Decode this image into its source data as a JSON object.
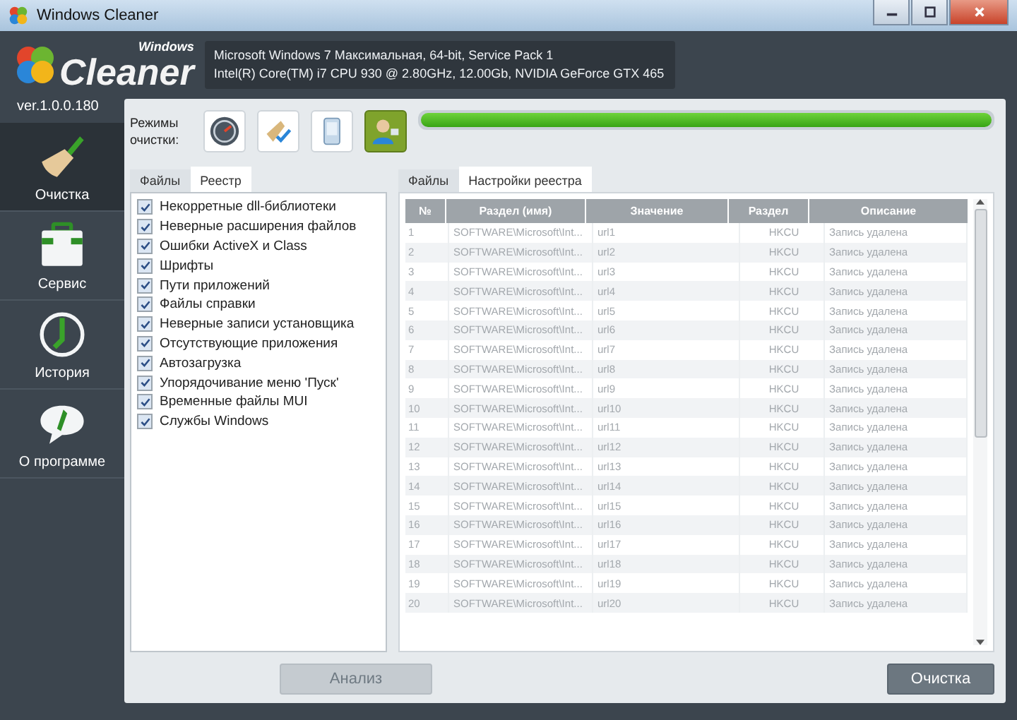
{
  "window": {
    "title": "Windows Cleaner"
  },
  "logo": {
    "small": "Windows",
    "big": "Cleaner",
    "version": "ver.1.0.0.180"
  },
  "system_info": [
    "Microsoft Windows 7 Максимальная, 64-bit, Service Pack 1",
    "Intel(R) Core(TM) i7 CPU 930 @ 2.80GHz, 12.00Gb, NVIDIA GeForce GTX 465"
  ],
  "sidebar": {
    "items": [
      {
        "label": "Очистка",
        "kind": "broom",
        "selected": true
      },
      {
        "label": "Сервис",
        "kind": "toolbox",
        "selected": false
      },
      {
        "label": "История",
        "kind": "clock",
        "selected": false
      },
      {
        "label": "О программе",
        "kind": "info",
        "selected": false
      }
    ]
  },
  "modes": {
    "label": "Режимы очистки:",
    "items": [
      {
        "kind": "gauge",
        "selected": false
      },
      {
        "kind": "broom",
        "selected": false
      },
      {
        "kind": "phone",
        "selected": false
      },
      {
        "kind": "person",
        "selected": true
      }
    ]
  },
  "progress": {
    "level": 1
  },
  "left_tabs": [
    {
      "label": "Файлы",
      "selected": false
    },
    {
      "label": "Реестр",
      "selected": true
    }
  ],
  "checklist": [
    {
      "label": "Некорретные dll-библиотеки",
      "checked": true
    },
    {
      "label": "Неверные расширения файлов",
      "checked": true
    },
    {
      "label": "Ошибки ActiveX и Class",
      "checked": true
    },
    {
      "label": "Шрифты",
      "checked": true
    },
    {
      "label": "Пути приложений",
      "checked": true
    },
    {
      "label": "Файлы справки",
      "checked": true
    },
    {
      "label": "Неверные записи установщика",
      "checked": true
    },
    {
      "label": "Отсутствующие приложения",
      "checked": true
    },
    {
      "label": "Автозагрузка",
      "checked": true
    },
    {
      "label": "Упорядочивание меню 'Пуск'",
      "checked": true
    },
    {
      "label": "Временные файлы MUI",
      "checked": true
    },
    {
      "label": "Службы Windows",
      "checked": true
    }
  ],
  "right_tabs": [
    {
      "label": "Файлы",
      "selected": false
    },
    {
      "label": "Настройки реестра",
      "selected": true
    }
  ],
  "table": {
    "columns": [
      "№",
      "Раздел (имя)",
      "Значение",
      "Раздел",
      "Описание"
    ],
    "rows": [
      [
        "1",
        "SOFTWARE\\Microsoft\\Int...",
        "url1",
        "HKCU",
        "Запись удалена"
      ],
      [
        "2",
        "SOFTWARE\\Microsoft\\Int...",
        "url2",
        "HKCU",
        "Запись удалена"
      ],
      [
        "3",
        "SOFTWARE\\Microsoft\\Int...",
        "url3",
        "HKCU",
        "Запись удалена"
      ],
      [
        "4",
        "SOFTWARE\\Microsoft\\Int...",
        "url4",
        "HKCU",
        "Запись удалена"
      ],
      [
        "5",
        "SOFTWARE\\Microsoft\\Int...",
        "url5",
        "HKCU",
        "Запись удалена"
      ],
      [
        "6",
        "SOFTWARE\\Microsoft\\Int...",
        "url6",
        "HKCU",
        "Запись удалена"
      ],
      [
        "7",
        "SOFTWARE\\Microsoft\\Int...",
        "url7",
        "HKCU",
        "Запись удалена"
      ],
      [
        "8",
        "SOFTWARE\\Microsoft\\Int...",
        "url8",
        "HKCU",
        "Запись удалена"
      ],
      [
        "9",
        "SOFTWARE\\Microsoft\\Int...",
        "url9",
        "HKCU",
        "Запись удалена"
      ],
      [
        "10",
        "SOFTWARE\\Microsoft\\Int...",
        "url10",
        "HKCU",
        "Запись удалена"
      ],
      [
        "11",
        "SOFTWARE\\Microsoft\\Int...",
        "url11",
        "HKCU",
        "Запись удалена"
      ],
      [
        "12",
        "SOFTWARE\\Microsoft\\Int...",
        "url12",
        "HKCU",
        "Запись удалена"
      ],
      [
        "13",
        "SOFTWARE\\Microsoft\\Int...",
        "url13",
        "HKCU",
        "Запись удалена"
      ],
      [
        "14",
        "SOFTWARE\\Microsoft\\Int...",
        "url14",
        "HKCU",
        "Запись удалена"
      ],
      [
        "15",
        "SOFTWARE\\Microsoft\\Int...",
        "url15",
        "HKCU",
        "Запись удалена"
      ],
      [
        "16",
        "SOFTWARE\\Microsoft\\Int...",
        "url16",
        "HKCU",
        "Запись удалена"
      ],
      [
        "17",
        "SOFTWARE\\Microsoft\\Int...",
        "url17",
        "HKCU",
        "Запись удалена"
      ],
      [
        "18",
        "SOFTWARE\\Microsoft\\Int...",
        "url18",
        "HKCU",
        "Запись удалена"
      ],
      [
        "19",
        "SOFTWARE\\Microsoft\\Int...",
        "url19",
        "HKCU",
        "Запись удалена"
      ],
      [
        "20",
        "SOFTWARE\\Microsoft\\Int...",
        "url20",
        "HKCU",
        "Запись удалена"
      ]
    ]
  },
  "buttons": [
    {
      "label": "Анализ",
      "disabled": true
    },
    {
      "label": "Очистка",
      "disabled": false
    }
  ]
}
